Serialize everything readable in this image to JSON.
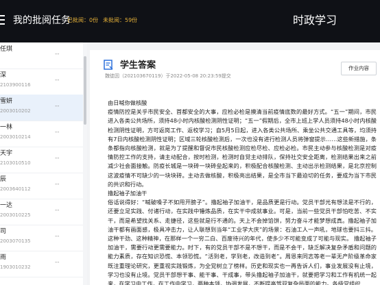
{
  "header": {
    "title": "我的批阅任务",
    "graded": "已批阅：0份",
    "ungraded": "未批阅：59份",
    "brand": "时政学习"
  },
  "students": [
    {
      "name": "任琪",
      "id": "",
      "status": "--"
    },
    {
      "name": "深",
      "id": "2103900116",
      "status": "--"
    },
    {
      "name": "雪妍",
      "id": "2003010202",
      "status": "--"
    },
    {
      "name": "一林",
      "id": "2003010214",
      "status": "--"
    },
    {
      "name": "天宇",
      "id": "2103010510",
      "status": "--"
    },
    {
      "name": "辰",
      "id": "2003640112",
      "status": "--"
    },
    {
      "name": "一达",
      "id": "2003010225",
      "status": "--"
    },
    {
      "name": "司",
      "id": "2003070135",
      "status": "--"
    },
    {
      "name": "雨",
      "id": "1903010232",
      "status": "--"
    }
  ],
  "answer": {
    "title": "学生答案",
    "meta": "魏徒因（202103670119）于2022-05-08 20:23:59提交",
    "button": "作业内容",
    "h1": "由日喊你做核酸",
    "p1": "疫情防控是关乎市民安全、首都安全的大事，应检必检是摸清当前疫情底数的最好方式。“五一”期间，市民进入各类公共场所，须持48小时内核酸检测阴性证明；“五一”假期后，全市上班上学人员须持48小时内核酸检测阴性证明，方可返岗工作、返校学习；自5月5日起，进入各类公共场所、乘坐公共交通工具等，均须持有7日内核酸检测阴性证明；区域三轮核酸检测后，一次也没有进行检测人员将弹窗提示……这些新措施，条条都指向核酸检测，就是为了提醒和督促市民核酸检测应检尽检、应检必检。市民主动参与核酸检测是对疫情防控工作的支持，请主动配合，按时检测，检测时自觉主动排队，保持社交安全距离，检测结果出来之前减少社会面接触。防疫长城是一块砖一块砖垒起来的，积极配合核酸检测、主动出示检测结果，是北京控制这波疫情不可缺少的一块块砖。主动去做核酸，积极亮出结果，是全市当下最迫切的任务，要成为当下市民的共识和行动。",
    "h2": "撸起袖子加油干",
    "p2": "俗话说得好：“喊破嗓子不如甩开膀子”。撸起袖子加油干，是品质更是行动。党员干部光有想法是不行的，还要立足实践、付诸行动，在实践中锤炼品质，在实干中成就事业。可是，当前一些党员干部怕吃苦、不实干，而是希望找关系、走捷径，这些就是行不通的。天上不会掉馅饼，努力奋斗才能梦想成真。撸起袖子加油干都有画面感，极具冲击力，让人联想到当年“工业学大庆”的场景：石油工人一声吼，地球也要抖三抖。这种干劲、这种精神，在那样一个一穷二白、百废待兴的年代，使多少不可能变成了可能与现实。        撸起袖子加油干，需要行动更需要能力。时下，有的党员干部不是不想干，而是不会干，缺乏解决复杂矛盾和问题的能力素质，存在知识恐慌、本领恐慌。“活到老，学到老，改造到老”。周恩来同志等老一辈无产阶级革命家既注重理论研究，更重视实践锻炼，为全党树立了榜样。历史和现实也一再告诉人们，事业发展没有止境，学习也没有止境。党员干部想干事、能干事、干成事，带头撸起袖子加油干，就要把学习和工作有机统一起来，在学习中工作，在工作中学习，两种本领，协调发展，不断提高驾驭复杂局面的能力。各级党组织"
  }
}
